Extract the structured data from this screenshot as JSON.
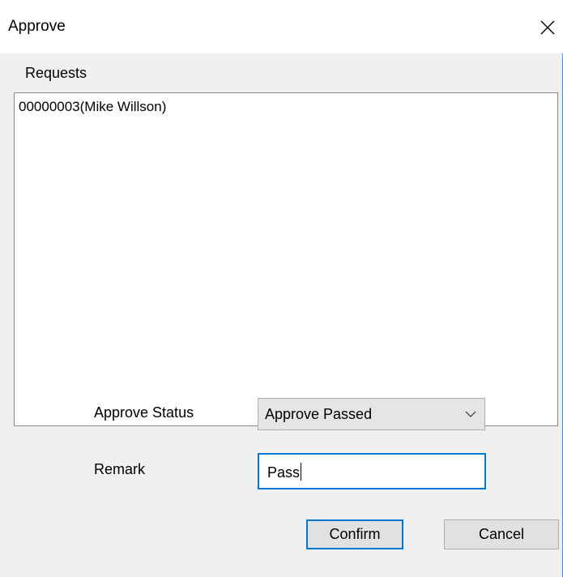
{
  "window": {
    "title": "Approve",
    "close_glyph": "close-icon"
  },
  "requests": {
    "label": "Requests",
    "items": [
      "00000003(Mike Willson)"
    ]
  },
  "approve_status": {
    "label": "Approve Status",
    "selected": "Approve Passed"
  },
  "remark": {
    "label": "Remark",
    "value": "Pass"
  },
  "buttons": {
    "confirm": "Confirm",
    "cancel": "Cancel"
  },
  "colors": {
    "accent": "#0078d7",
    "face": "#f0f0f0",
    "button": "#e1e1e1"
  }
}
